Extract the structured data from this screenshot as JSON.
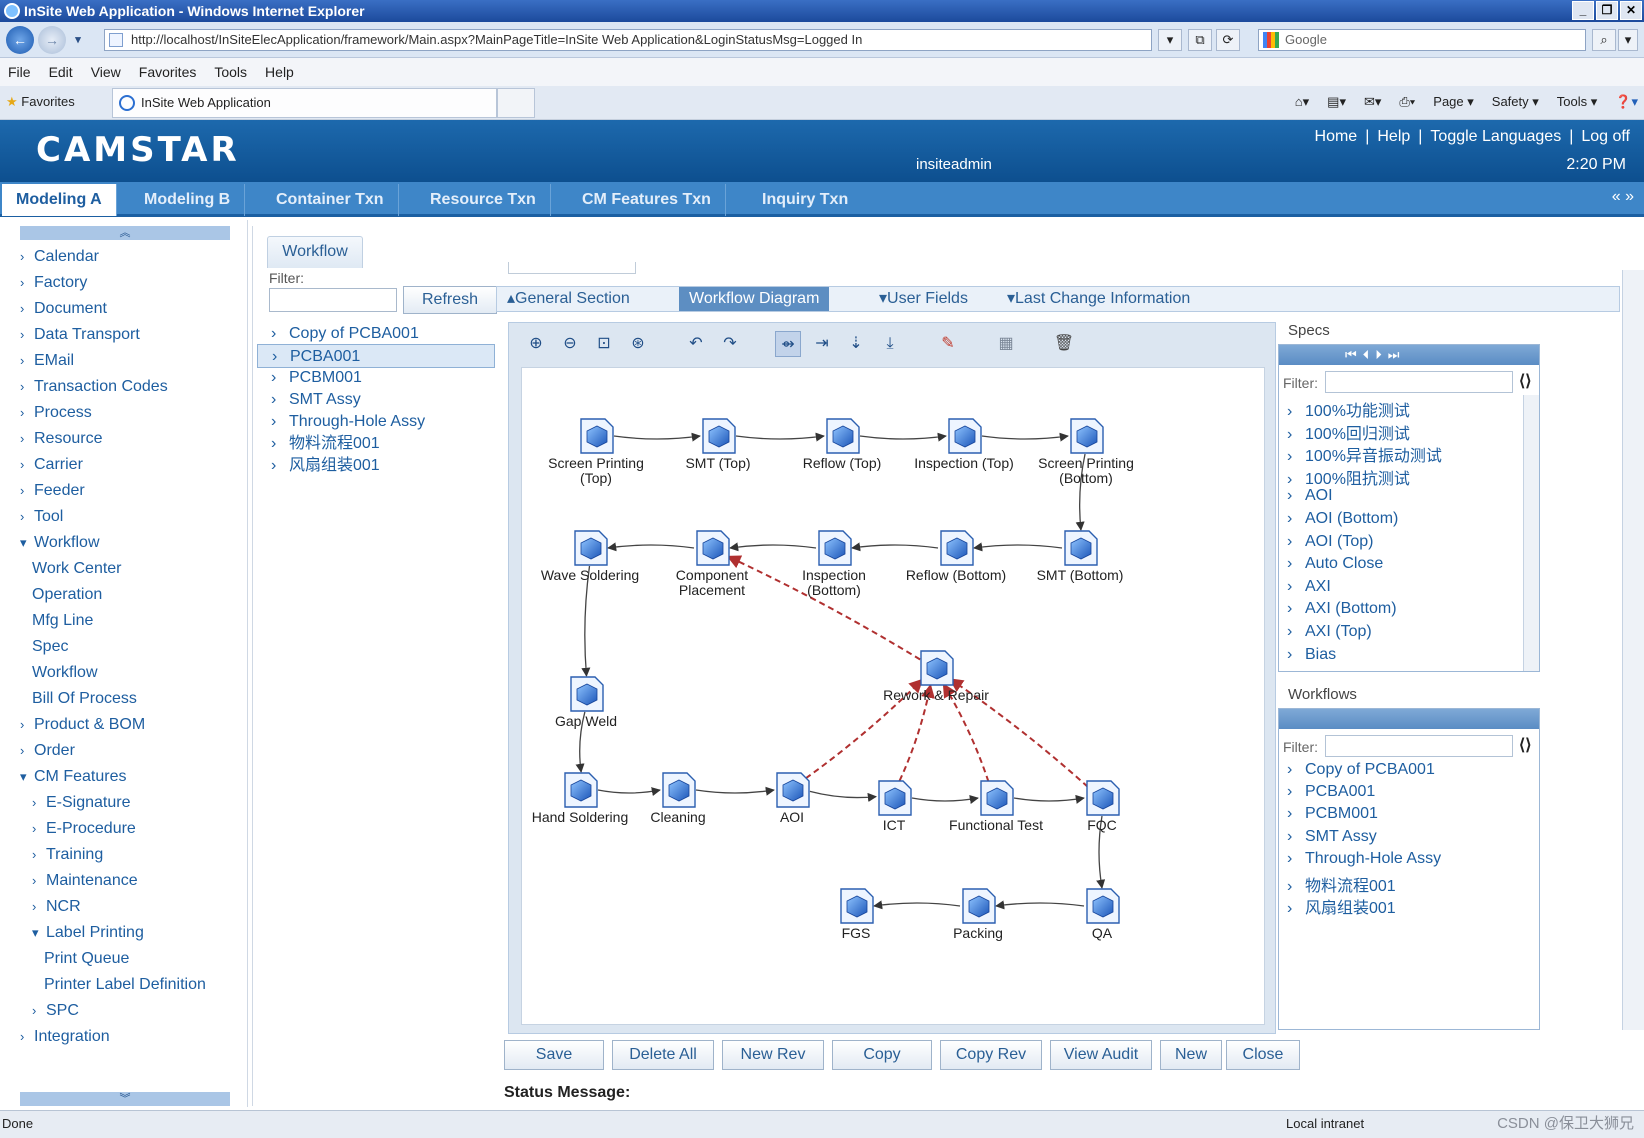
{
  "browser": {
    "title": "InSite Web Application - Windows Internet Explorer",
    "url": "http://localhost/InSiteElecApplication/framework/Main.aspx?MainPageTitle=InSite Web Application&LoginStatusMsg=Logged In",
    "search_placeholder": "Google",
    "menu": [
      "File",
      "Edit",
      "View",
      "Favorites",
      "Tools",
      "Help"
    ],
    "favorites_label": "Favorites",
    "tab_title": "InSite Web Application",
    "command_items": [
      "Page ▾",
      "Safety ▾",
      "Tools ▾"
    ],
    "status_done": "Done",
    "status_zone": "Local intranet",
    "watermark": "CSDN @保卫大狮兄"
  },
  "app": {
    "logo": "CAMSTAR",
    "user": "insiteadmin",
    "time": "2:20 PM",
    "top_links": [
      "Home",
      "|",
      "Help",
      "|",
      "Toggle Languages",
      "|",
      "Log off"
    ],
    "main_tabs": [
      "Modeling A",
      "Modeling B",
      "Container Txn",
      "Resource Txn",
      "CM Features Txn",
      "Inquiry Txn"
    ],
    "tab_arrows": "«  »"
  },
  "left_nav": [
    {
      "label": "Calendar",
      "chev": "›",
      "level": 0
    },
    {
      "label": "Factory",
      "chev": "›",
      "level": 0
    },
    {
      "label": "Document",
      "chev": "›",
      "level": 0
    },
    {
      "label": "Data Transport",
      "chev": "›",
      "level": 0
    },
    {
      "label": "EMail",
      "chev": "›",
      "level": 0
    },
    {
      "label": "Transaction Codes",
      "chev": "›",
      "level": 0
    },
    {
      "label": "Process",
      "chev": "›",
      "level": 0
    },
    {
      "label": "Resource",
      "chev": "›",
      "level": 0
    },
    {
      "label": "Carrier",
      "chev": "›",
      "level": 0
    },
    {
      "label": "Feeder",
      "chev": "›",
      "level": 0
    },
    {
      "label": "Tool",
      "chev": "›",
      "level": 0
    },
    {
      "label": "Workflow",
      "chev": "▾",
      "level": 0
    },
    {
      "label": "Work Center",
      "chev": "",
      "level": 1
    },
    {
      "label": "Operation",
      "chev": "",
      "level": 1
    },
    {
      "label": "Mfg Line",
      "chev": "",
      "level": 1
    },
    {
      "label": "Spec",
      "chev": "",
      "level": 1
    },
    {
      "label": "Workflow",
      "chev": "",
      "level": 1
    },
    {
      "label": "Bill Of Process",
      "chev": "",
      "level": 1
    },
    {
      "label": "Product & BOM",
      "chev": "›",
      "level": 0
    },
    {
      "label": "Order",
      "chev": "›",
      "level": 0
    },
    {
      "label": "CM Features",
      "chev": "▾",
      "level": 0
    },
    {
      "label": "E-Signature",
      "chev": "›",
      "level": 2
    },
    {
      "label": "E-Procedure",
      "chev": "›",
      "level": 2
    },
    {
      "label": "Training",
      "chev": "›",
      "level": 2
    },
    {
      "label": "Maintenance",
      "chev": "›",
      "level": 2
    },
    {
      "label": "NCR",
      "chev": "›",
      "level": 2
    },
    {
      "label": "Label Printing",
      "chev": "▾",
      "level": 2
    },
    {
      "label": "Print Queue",
      "chev": "",
      "level": 3
    },
    {
      "label": "Printer Label Definition",
      "chev": "",
      "level": 3
    },
    {
      "label": "SPC",
      "chev": "›",
      "level": 2
    },
    {
      "label": "Integration",
      "chev": "›",
      "level": 0
    }
  ],
  "workflow_panel": {
    "tab": "Workflow",
    "filter_label": "Filter:",
    "refresh": "Refresh",
    "items": [
      "Copy of PCBA001",
      "PCBA001",
      "PCBM001",
      "SMT Assy",
      "Through-Hole Assy",
      "物料流程001",
      "风扇组装001"
    ],
    "selected": "PCBA001"
  },
  "section_tabs": [
    "▴General Section",
    "Workflow Diagram",
    "▾User Fields",
    "▾Last Change Information"
  ],
  "toolbar_icons": [
    "zoom-in-icon",
    "zoom-out-icon",
    "zoom-fit-icon",
    "zoom-actual-icon",
    "undo-icon",
    "redo-icon",
    "connect-horizontal-icon",
    "connect-horizontal-alt-icon",
    "connect-vertical-icon",
    "connect-vertical-alt-icon",
    "pencil-icon",
    "grid-icon",
    "delete-icon"
  ],
  "diagram": {
    "steps": [
      {
        "id": "sp_top",
        "label": [
          "Screen Printing",
          "(Top)"
        ]
      },
      {
        "id": "smt_top",
        "label": [
          "SMT (Top)"
        ]
      },
      {
        "id": "reflow_top",
        "label": [
          "Reflow (Top)"
        ]
      },
      {
        "id": "insp_top",
        "label": [
          "Inspection (Top)"
        ]
      },
      {
        "id": "sp_bot",
        "label": [
          "Screen Printing",
          "(Bottom)"
        ]
      },
      {
        "id": "wave",
        "label": [
          "Wave Soldering"
        ]
      },
      {
        "id": "comp",
        "label": [
          "Component",
          "Placement"
        ]
      },
      {
        "id": "insp_bot",
        "label": [
          "Inspection",
          "(Bottom)"
        ]
      },
      {
        "id": "reflow_bot",
        "label": [
          "Reflow (Bottom)"
        ]
      },
      {
        "id": "smt_bot",
        "label": [
          "SMT (Bottom)"
        ]
      },
      {
        "id": "rework",
        "label": [
          "Rework & Repair"
        ]
      },
      {
        "id": "gap",
        "label": [
          "Gap Weld"
        ]
      },
      {
        "id": "hand",
        "label": [
          "Hand Soldering"
        ]
      },
      {
        "id": "clean",
        "label": [
          "Cleaning"
        ]
      },
      {
        "id": "aoi",
        "label": [
          "AOI"
        ]
      },
      {
        "id": "ict",
        "label": [
          "ICT"
        ]
      },
      {
        "id": "func",
        "label": [
          "Functional Test"
        ]
      },
      {
        "id": "fqc",
        "label": [
          "FQC"
        ]
      },
      {
        "id": "fgs",
        "label": [
          "FGS"
        ]
      },
      {
        "id": "packing",
        "label": [
          "Packing"
        ]
      },
      {
        "id": "qa",
        "label": [
          "QA"
        ]
      }
    ],
    "links": [
      [
        "sp_top",
        "smt_top"
      ],
      [
        "smt_top",
        "reflow_top"
      ],
      [
        "reflow_top",
        "insp_top"
      ],
      [
        "insp_top",
        "sp_bot"
      ],
      [
        "sp_bot",
        "smt_bot"
      ],
      [
        "smt_bot",
        "reflow_bot"
      ],
      [
        "reflow_bot",
        "insp_bot"
      ],
      [
        "insp_bot",
        "comp"
      ],
      [
        "comp",
        "wave"
      ],
      [
        "wave",
        "gap"
      ],
      [
        "gap",
        "hand"
      ],
      [
        "hand",
        "clean"
      ],
      [
        "clean",
        "aoi"
      ],
      [
        "aoi",
        "ict"
      ],
      [
        "ict",
        "func"
      ],
      [
        "func",
        "fqc"
      ],
      [
        "fqc",
        "qa"
      ],
      [
        "qa",
        "packing"
      ],
      [
        "packing",
        "fgs"
      ]
    ],
    "rework_links": [
      [
        "aoi",
        "rework"
      ],
      [
        "ict",
        "rework"
      ],
      [
        "func",
        "rework"
      ],
      [
        "fqc",
        "rework"
      ],
      [
        "rework",
        "comp"
      ]
    ]
  },
  "specs": {
    "label": "Specs",
    "filter_label": "Filter:",
    "items": [
      "100%功能测试",
      "100%回归测试",
      "100%异音振动测试",
      "100%阻抗测试",
      "AOI",
      "AOI (Bottom)",
      "AOI (Top)",
      "Auto Close",
      "AXI",
      "AXI (Bottom)",
      "AXI (Top)",
      "Bias"
    ]
  },
  "workflows": {
    "label": "Workflows",
    "filter_label": "Filter:",
    "items": [
      "Copy of PCBA001",
      "PCBA001",
      "PCBM001",
      "SMT Assy",
      "Through-Hole Assy",
      "物料流程001",
      "风扇组装001"
    ]
  },
  "buttons": [
    "Save",
    "Delete All",
    "New Rev",
    "Copy",
    "Copy Rev",
    "View Audit",
    "New",
    "Close"
  ],
  "status_message_label": "Status Message:"
}
